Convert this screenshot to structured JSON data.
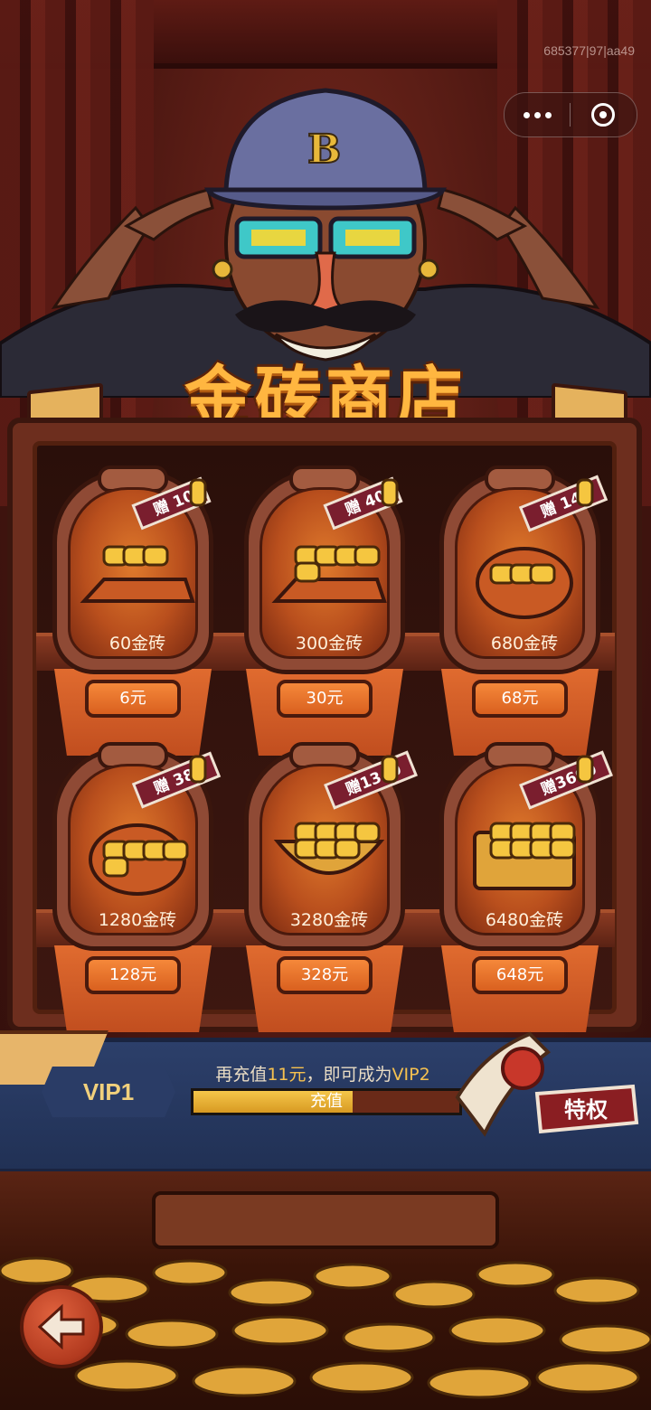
{
  "debug_id": "685377|97|aa49",
  "capsule": {
    "more_icon": "more-dots-icon",
    "close_icon": "target-circle-icon"
  },
  "title": "金砖商店",
  "items": [
    {
      "amount": "60金砖",
      "bonus": "赠 10",
      "price": "6元"
    },
    {
      "amount": "300金砖",
      "bonus": "赠 40",
      "price": "30元"
    },
    {
      "amount": "680金砖",
      "bonus": "赠 140",
      "price": "68元"
    },
    {
      "amount": "1280金砖",
      "bonus": "赠 380",
      "price": "128元"
    },
    {
      "amount": "3280金砖",
      "bonus": "赠1340",
      "price": "328元"
    },
    {
      "amount": "6480金砖",
      "bonus": "赠3600",
      "price": "648元"
    }
  ],
  "vip": {
    "level": "VIP1",
    "message_prefix": "再充值",
    "message_amount": "11元",
    "message_mid": "，即可成为",
    "message_target": "VIP2",
    "button_label": "充值",
    "progress": 0.6,
    "privilege_label": "特权"
  },
  "back_icon": "back-arrow-icon",
  "colors": {
    "gold": "#ffb640",
    "vip_band": "#2c3f6a",
    "price_button": "#e5702a"
  }
}
